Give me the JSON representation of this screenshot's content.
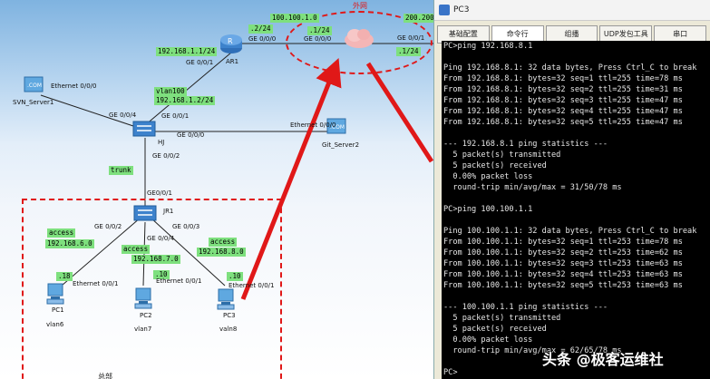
{
  "topology": {
    "cloud_label": "外网",
    "branch_label": "总部",
    "devices": {
      "ar1": "AR1",
      "hj": "HJ",
      "jr1": "JR1",
      "svn": "SVN_Server1",
      "git": "Git_Server2",
      "pc1": "PC1",
      "pc2": "PC2",
      "pc3": "PC3"
    },
    "ips": {
      "top1": "100.100.1.0",
      "top2": "200.200.",
      "ar1_up": ".2/24",
      "cloud_left": ".1/24",
      "cloud_right": ".1/24",
      "ar1_left": "192.168.1.1/24",
      "vlan100": "vlan100",
      "hj_ip": "192.168.1.2/24",
      "trunk": "trunk",
      "access1": "access",
      "subnet6": "192.168.6.0",
      "access2": "access",
      "subnet7": "192.168.7.0",
      "access3": "access",
      "subnet8": "192.168.8.0",
      "host1": ".18",
      "host2": ".10",
      "host3": ".10"
    },
    "ports": {
      "ar1_ge000": "GE 0/0/0",
      "ar1_ge001": "GE 0/0/1",
      "cloud_ge000": "GE 0/0/0",
      "cloud_ge001": "GE 0/0/1",
      "svn_eth": "Ethernet 0/0/0",
      "hj_ge004": "GE 0/0/4",
      "hj_ge001": "GE 0/0/1",
      "hj_ge000": "GE 0/0/0",
      "hj_ge002": "GE 0/0/2",
      "git_eth": "Ethernet 0/0/0",
      "jr1_ge001": "GE0/0/1",
      "jr1_ge002": "GE 0/0/2",
      "jr1_ge003": "GE 0/0/3",
      "jr1_ge004": "GE 0/0/4",
      "pc1_eth": "Ethernet 0/0/1",
      "pc2_eth": "Ethernet 0/0/1",
      "pc3_eth": "Ethernet 0/0/1"
    },
    "vlans": {
      "pc1": "vlan6",
      "pc2": "vlan7",
      "pc3": "valn8"
    }
  },
  "window": {
    "title": "PC3",
    "tabs": [
      "基础配置",
      "命令行",
      "组播",
      "UDP发包工具",
      "串口"
    ],
    "active_tab": 1,
    "console_lines": [
      "PC>ping 192.168.8.1",
      "",
      "Ping 192.168.8.1: 32 data bytes, Press Ctrl_C to break",
      "From 192.168.8.1: bytes=32 seq=1 ttl=255 time=78 ms",
      "From 192.168.8.1: bytes=32 seq=2 ttl=255 time=31 ms",
      "From 192.168.8.1: bytes=32 seq=3 ttl=255 time=47 ms",
      "From 192.168.8.1: bytes=32 seq=4 ttl=255 time=47 ms",
      "From 192.168.8.1: bytes=32 seq=5 ttl=255 time=47 ms",
      "",
      "--- 192.168.8.1 ping statistics ---",
      "  5 packet(s) transmitted",
      "  5 packet(s) received",
      "  0.00% packet loss",
      "  round-trip min/avg/max = 31/50/78 ms",
      "",
      "PC>ping 100.100.1.1",
      "",
      "Ping 100.100.1.1: 32 data bytes, Press Ctrl_C to break",
      "From 100.100.1.1: bytes=32 seq=1 ttl=253 time=78 ms",
      "From 100.100.1.1: bytes=32 seq=2 ttl=253 time=62 ms",
      "From 100.100.1.1: bytes=32 seq=3 ttl=253 time=63 ms",
      "From 100.100.1.1: bytes=32 seq=4 ttl=253 time=63 ms",
      "From 100.100.1.1: bytes=32 seq=5 ttl=253 time=63 ms",
      "",
      "--- 100.100.1.1 ping statistics ---",
      "  5 packet(s) transmitted",
      "  5 packet(s) received",
      "  0.00% packet loss",
      "  round-trip min/avg/max = 62/65/78 ms",
      "",
      "PC>"
    ]
  },
  "watermark": "头条 @极客运维社",
  "colors": {
    "annotation_red": "#e01818",
    "label_green": "#7ee07e",
    "console_bg": "#000000"
  }
}
